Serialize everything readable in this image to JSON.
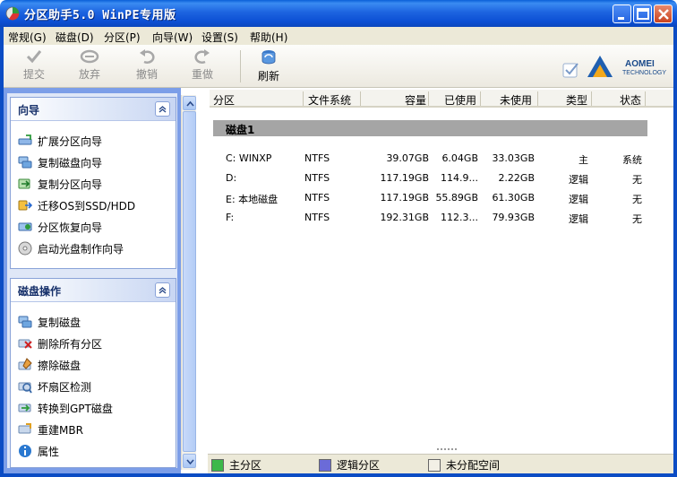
{
  "window": {
    "title": "分区助手5.0 WinPE专用版"
  },
  "menu": [
    "常规(G)",
    "磁盘(D)",
    "分区(P)",
    "向导(W)",
    "设置(S)",
    "帮助(H)"
  ],
  "toolbar": {
    "submit": "提交",
    "discard": "放弃",
    "undo": "撤销",
    "redo": "重做",
    "refresh": "刷新"
  },
  "logo": {
    "name": "AOMEI",
    "sub": "TECHNOLOGY"
  },
  "wizard_group": {
    "title": "向导",
    "items": [
      "扩展分区向导",
      "复制磁盘向导",
      "复制分区向导",
      "迁移OS到SSD/HDD",
      "分区恢复向导",
      "启动光盘制作向导"
    ]
  },
  "disk_ops_group": {
    "title": "磁盘操作",
    "items": [
      "复制磁盘",
      "删除所有分区",
      "擦除磁盘",
      "坏扇区检测",
      "转换到GPT磁盘",
      "重建MBR",
      "属性"
    ]
  },
  "table": {
    "headers": [
      "分区",
      "文件系统",
      "容量",
      "已使用",
      "未使用",
      "类型",
      "状态"
    ],
    "disk_label": "磁盘1",
    "rows": [
      [
        "C: WINXP",
        "NTFS",
        "39.07GB",
        "6.04GB",
        "33.03GB",
        "主",
        "系统"
      ],
      [
        "D:",
        "NTFS",
        "117.19GB",
        "114.9...",
        "2.22GB",
        "逻辑",
        "无"
      ],
      [
        "E: 本地磁盘",
        "NTFS",
        "117.19GB",
        "55.89GB",
        "61.30GB",
        "逻辑",
        "无"
      ],
      [
        "F:",
        "NTFS",
        "192.31GB",
        "112.3...",
        "79.93GB",
        "逻辑",
        "无"
      ]
    ]
  },
  "legend": {
    "items": [
      "主分区",
      "逻辑分区",
      "未分配空间"
    ],
    "colors": [
      "#3cb84a",
      "#6b6bd8",
      "#f2f0e6"
    ]
  }
}
